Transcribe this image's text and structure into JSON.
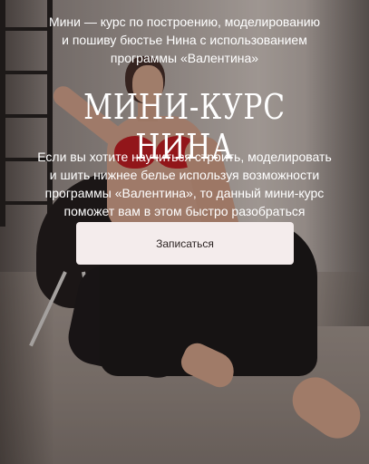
{
  "hero": {
    "intro_line_1": "Мини — курс по построению, моделированию",
    "intro_line_2": "и пошиву бюстье Нина с использованием",
    "intro_line_3": "программы «Валентина»",
    "title": "МИНИ-КУРС НИНА",
    "description_line_1": "Если вы хотите научиться строить, моделировать",
    "description_line_2": "и шить нижнее белье используя возможности",
    "description_line_3": "программы «Валентина», то данный мини-курс",
    "description_line_4": "поможет вам в этом быстро разобраться",
    "cta_label": "Записаться"
  },
  "colors": {
    "text": "#ffffff",
    "button_background": "#f4ecec",
    "button_text": "#2d2524",
    "accent_red": "#b3161b"
  }
}
